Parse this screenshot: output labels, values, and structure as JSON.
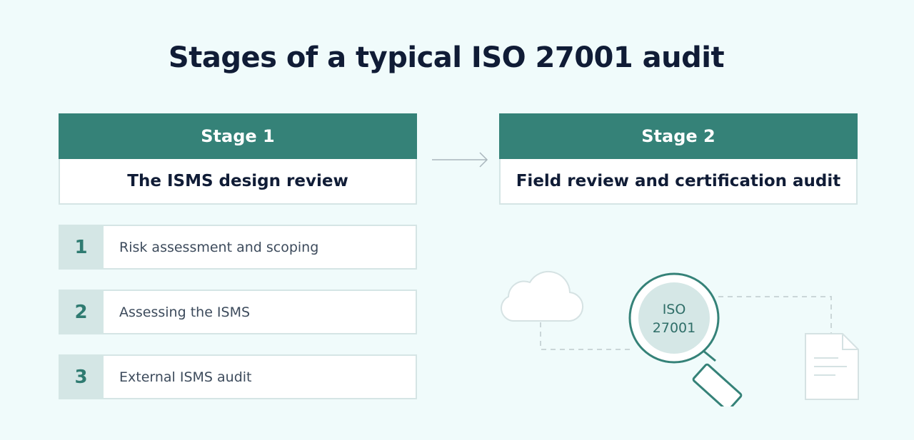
{
  "title": "Stages of a typical ISO 27001 audit",
  "stages": [
    {
      "heading": "Stage 1",
      "subtitle": "The ISMS design review"
    },
    {
      "heading": "Stage 2",
      "subtitle": "Field review and certification audit"
    }
  ],
  "steps": [
    {
      "number": "1",
      "label": "Risk assessment and scoping"
    },
    {
      "number": "2",
      "label": "Assessing the ISMS"
    },
    {
      "number": "3",
      "label": "External ISMS audit"
    }
  ],
  "illustration": {
    "lens_line1": "ISO",
    "lens_line2": "27001",
    "icons": [
      "cloud-icon",
      "magnifying-glass-icon",
      "document-icon"
    ]
  },
  "colors": {
    "background": "#f0fbfb",
    "stage_header": "#358278",
    "step_number_bg": "#d4e6e5",
    "accent_text": "#2f7b71"
  }
}
